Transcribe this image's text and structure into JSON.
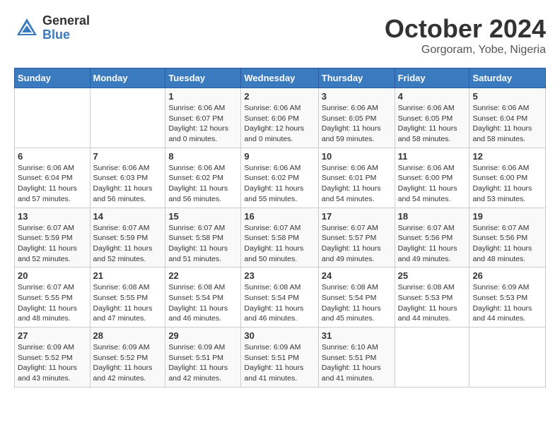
{
  "header": {
    "logo_general": "General",
    "logo_blue": "Blue",
    "month_title": "October 2024",
    "location": "Gorgoram, Yobe, Nigeria"
  },
  "weekdays": [
    "Sunday",
    "Monday",
    "Tuesday",
    "Wednesday",
    "Thursday",
    "Friday",
    "Saturday"
  ],
  "weeks": [
    [
      null,
      null,
      {
        "day": 1,
        "sunrise": "Sunrise: 6:06 AM",
        "sunset": "Sunset: 6:07 PM",
        "daylight": "Daylight: 12 hours and 0 minutes."
      },
      {
        "day": 2,
        "sunrise": "Sunrise: 6:06 AM",
        "sunset": "Sunset: 6:06 PM",
        "daylight": "Daylight: 12 hours and 0 minutes."
      },
      {
        "day": 3,
        "sunrise": "Sunrise: 6:06 AM",
        "sunset": "Sunset: 6:05 PM",
        "daylight": "Daylight: 11 hours and 59 minutes."
      },
      {
        "day": 4,
        "sunrise": "Sunrise: 6:06 AM",
        "sunset": "Sunset: 6:05 PM",
        "daylight": "Daylight: 11 hours and 58 minutes."
      },
      {
        "day": 5,
        "sunrise": "Sunrise: 6:06 AM",
        "sunset": "Sunset: 6:04 PM",
        "daylight": "Daylight: 11 hours and 58 minutes."
      }
    ],
    [
      {
        "day": 6,
        "sunrise": "Sunrise: 6:06 AM",
        "sunset": "Sunset: 6:04 PM",
        "daylight": "Daylight: 11 hours and 57 minutes."
      },
      {
        "day": 7,
        "sunrise": "Sunrise: 6:06 AM",
        "sunset": "Sunset: 6:03 PM",
        "daylight": "Daylight: 11 hours and 56 minutes."
      },
      {
        "day": 8,
        "sunrise": "Sunrise: 6:06 AM",
        "sunset": "Sunset: 6:02 PM",
        "daylight": "Daylight: 11 hours and 56 minutes."
      },
      {
        "day": 9,
        "sunrise": "Sunrise: 6:06 AM",
        "sunset": "Sunset: 6:02 PM",
        "daylight": "Daylight: 11 hours and 55 minutes."
      },
      {
        "day": 10,
        "sunrise": "Sunrise: 6:06 AM",
        "sunset": "Sunset: 6:01 PM",
        "daylight": "Daylight: 11 hours and 54 minutes."
      },
      {
        "day": 11,
        "sunrise": "Sunrise: 6:06 AM",
        "sunset": "Sunset: 6:00 PM",
        "daylight": "Daylight: 11 hours and 54 minutes."
      },
      {
        "day": 12,
        "sunrise": "Sunrise: 6:06 AM",
        "sunset": "Sunset: 6:00 PM",
        "daylight": "Daylight: 11 hours and 53 minutes."
      }
    ],
    [
      {
        "day": 13,
        "sunrise": "Sunrise: 6:07 AM",
        "sunset": "Sunset: 5:59 PM",
        "daylight": "Daylight: 11 hours and 52 minutes."
      },
      {
        "day": 14,
        "sunrise": "Sunrise: 6:07 AM",
        "sunset": "Sunset: 5:59 PM",
        "daylight": "Daylight: 11 hours and 52 minutes."
      },
      {
        "day": 15,
        "sunrise": "Sunrise: 6:07 AM",
        "sunset": "Sunset: 5:58 PM",
        "daylight": "Daylight: 11 hours and 51 minutes."
      },
      {
        "day": 16,
        "sunrise": "Sunrise: 6:07 AM",
        "sunset": "Sunset: 5:58 PM",
        "daylight": "Daylight: 11 hours and 50 minutes."
      },
      {
        "day": 17,
        "sunrise": "Sunrise: 6:07 AM",
        "sunset": "Sunset: 5:57 PM",
        "daylight": "Daylight: 11 hours and 49 minutes."
      },
      {
        "day": 18,
        "sunrise": "Sunrise: 6:07 AM",
        "sunset": "Sunset: 5:56 PM",
        "daylight": "Daylight: 11 hours and 49 minutes."
      },
      {
        "day": 19,
        "sunrise": "Sunrise: 6:07 AM",
        "sunset": "Sunset: 5:56 PM",
        "daylight": "Daylight: 11 hours and 48 minutes."
      }
    ],
    [
      {
        "day": 20,
        "sunrise": "Sunrise: 6:07 AM",
        "sunset": "Sunset: 5:55 PM",
        "daylight": "Daylight: 11 hours and 48 minutes."
      },
      {
        "day": 21,
        "sunrise": "Sunrise: 6:08 AM",
        "sunset": "Sunset: 5:55 PM",
        "daylight": "Daylight: 11 hours and 47 minutes."
      },
      {
        "day": 22,
        "sunrise": "Sunrise: 6:08 AM",
        "sunset": "Sunset: 5:54 PM",
        "daylight": "Daylight: 11 hours and 46 minutes."
      },
      {
        "day": 23,
        "sunrise": "Sunrise: 6:08 AM",
        "sunset": "Sunset: 5:54 PM",
        "daylight": "Daylight: 11 hours and 46 minutes."
      },
      {
        "day": 24,
        "sunrise": "Sunrise: 6:08 AM",
        "sunset": "Sunset: 5:54 PM",
        "daylight": "Daylight: 11 hours and 45 minutes."
      },
      {
        "day": 25,
        "sunrise": "Sunrise: 6:08 AM",
        "sunset": "Sunset: 5:53 PM",
        "daylight": "Daylight: 11 hours and 44 minutes."
      },
      {
        "day": 26,
        "sunrise": "Sunrise: 6:09 AM",
        "sunset": "Sunset: 5:53 PM",
        "daylight": "Daylight: 11 hours and 44 minutes."
      }
    ],
    [
      {
        "day": 27,
        "sunrise": "Sunrise: 6:09 AM",
        "sunset": "Sunset: 5:52 PM",
        "daylight": "Daylight: 11 hours and 43 minutes."
      },
      {
        "day": 28,
        "sunrise": "Sunrise: 6:09 AM",
        "sunset": "Sunset: 5:52 PM",
        "daylight": "Daylight: 11 hours and 42 minutes."
      },
      {
        "day": 29,
        "sunrise": "Sunrise: 6:09 AM",
        "sunset": "Sunset: 5:51 PM",
        "daylight": "Daylight: 11 hours and 42 minutes."
      },
      {
        "day": 30,
        "sunrise": "Sunrise: 6:09 AM",
        "sunset": "Sunset: 5:51 PM",
        "daylight": "Daylight: 11 hours and 41 minutes."
      },
      {
        "day": 31,
        "sunrise": "Sunrise: 6:10 AM",
        "sunset": "Sunset: 5:51 PM",
        "daylight": "Daylight: 11 hours and 41 minutes."
      },
      null,
      null
    ]
  ]
}
